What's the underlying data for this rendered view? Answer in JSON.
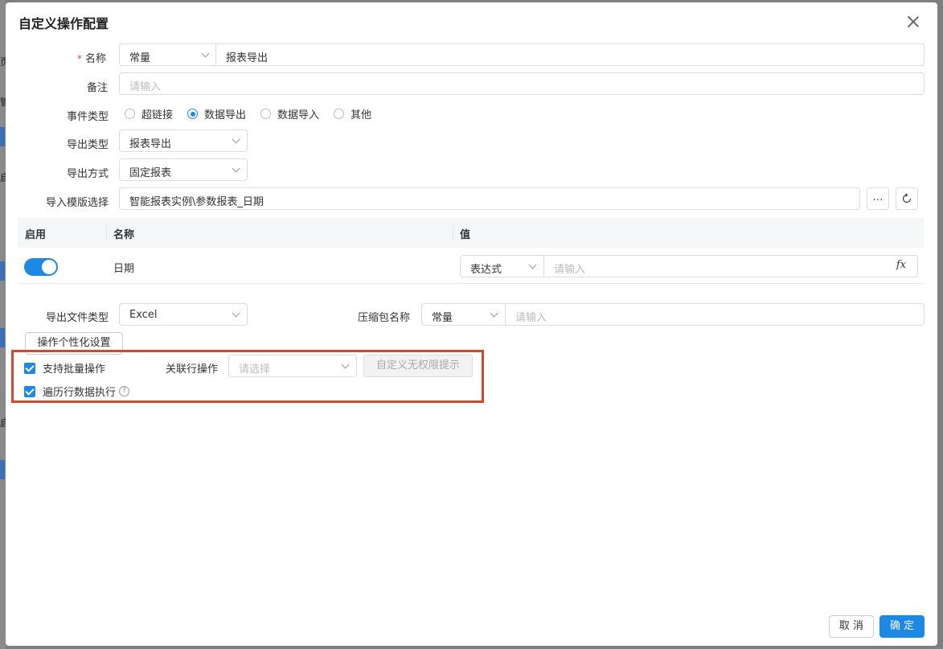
{
  "dialog": {
    "title": "自定义操作配置"
  },
  "form": {
    "name": {
      "label": "名称",
      "required_mark": "*",
      "type_value": "常量",
      "value": "报表导出"
    },
    "remark": {
      "label": "备注",
      "placeholder": "请输入"
    },
    "event_type": {
      "label": "事件类型",
      "options": [
        "超链接",
        "数据导出",
        "数据导入",
        "其他"
      ],
      "selected": "数据导出"
    },
    "export_type": {
      "label": "导出类型",
      "value": "报表导出"
    },
    "export_method": {
      "label": "导出方式",
      "value": "固定报表"
    },
    "template": {
      "label": "导入模版选择",
      "value": "智能报表实例\\参数报表_日期",
      "more_icon": "…"
    }
  },
  "table": {
    "headers": [
      "启用",
      "名称",
      "值"
    ],
    "rows": [
      {
        "enabled": true,
        "name": "日期",
        "value_type": "表达式",
        "placeholder": "请输入",
        "fx_label": "fx"
      }
    ]
  },
  "export_file": {
    "label": "导出文件类型",
    "value": "Excel"
  },
  "zip_name": {
    "label": "压缩包名称",
    "type_value": "常量",
    "placeholder": "请输入"
  },
  "personalize_button": "操作个性化设置",
  "batch": {
    "support_batch": {
      "label": "支持批量操作",
      "checked": true
    },
    "related_op": {
      "label": "关联行操作",
      "placeholder": "请选择"
    },
    "no_permission_button": "自定义无权限提示",
    "iterate_rows": {
      "label": "遍历行数据执行",
      "checked": true,
      "help_icon": "?"
    }
  },
  "footer": {
    "cancel": "取 消",
    "confirm": "确 定"
  },
  "background_glyphs": [
    "页",
    "管",
    "启",
    "启"
  ],
  "colors": {
    "primary": "#1e88e5",
    "highlight": "#d3472d",
    "required": "#e74c3c"
  }
}
